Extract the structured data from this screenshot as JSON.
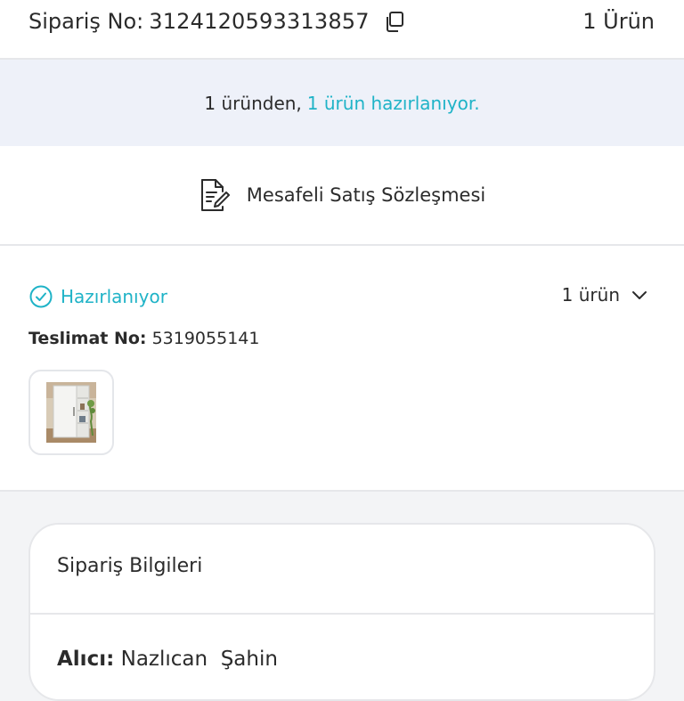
{
  "header": {
    "order_label": "Sipariş No:",
    "order_number": "3124120593313857",
    "item_count": "1 Ürün"
  },
  "status_banner": {
    "prefix": "1 üründen,",
    "highlight": "1 ürün hazırlanıyor."
  },
  "contract": {
    "label": "Mesafeli Satış Sözleşmesi"
  },
  "shipment": {
    "status": "Hazırlanıyor",
    "count": "1 ürün",
    "tracking_label": "Teslimat No:",
    "tracking_number": "5319055141"
  },
  "order_info": {
    "title": "Sipariş Bilgileri",
    "recipient_label": "Alıcı:",
    "recipient_name": "Nazlıcan  Şahin"
  },
  "colors": {
    "accent": "#1fb3c7",
    "banner_bg": "#eef1f9",
    "page_bg": "#f3f4f6",
    "text": "#2b2b2b"
  },
  "icons": {
    "copy": "copy-icon",
    "document": "document-edit-icon",
    "status": "check-circle-icon",
    "expand": "chevron-down-icon"
  }
}
